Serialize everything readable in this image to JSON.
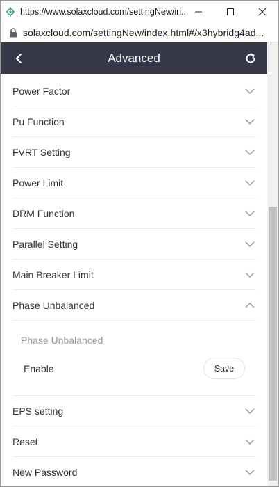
{
  "browser": {
    "title": "https://www.solaxcloud.com/settingNew/in...",
    "url": "solaxcloud.com/settingNew/index.html#/x3hybridg4ad..."
  },
  "header": {
    "title": "Advanced"
  },
  "menu": {
    "items": [
      {
        "label": "Power Factor"
      },
      {
        "label": "Pu Function"
      },
      {
        "label": "FVRT Setting"
      },
      {
        "label": "Power Limit"
      },
      {
        "label": "DRM Function"
      },
      {
        "label": "Parallel Setting"
      },
      {
        "label": "Main Breaker Limit"
      },
      {
        "label": "Phase Unbalanced"
      },
      {
        "label": "EPS setting"
      },
      {
        "label": "Reset"
      },
      {
        "label": "New Password"
      }
    ]
  },
  "phase_unbalanced_panel": {
    "subtitle": "Phase Unbalanced",
    "field_label": "Enable",
    "save_label": "Save"
  },
  "colors": {
    "header_bg": "#363849",
    "text": "#333333",
    "muted": "#9a9a9a"
  }
}
